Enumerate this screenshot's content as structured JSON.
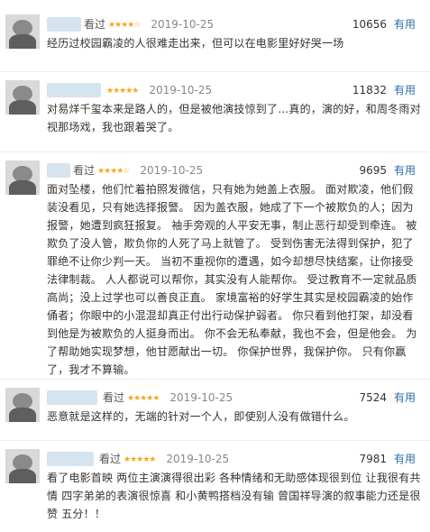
{
  "reviews": [
    {
      "seen": "看过",
      "stars": "★★★★☆",
      "date": "2019-10-25",
      "votes": "10656",
      "useful": "有用",
      "text": "经历过校园霸凌的人很难走出来，但可以在电影里好好哭一场"
    },
    {
      "seen": "看过",
      "stars": "★★★★★",
      "date": "2019-10-25",
      "votes": "11832",
      "useful": "有用",
      "text": "对易烊千玺本来是路人的，但是被他演技惊到了…真的，演的好，和周冬雨对视那场戏，我也跟着哭了。"
    },
    {
      "seen": "看过",
      "stars": "★★★★☆",
      "date": "2019-10-25",
      "votes": "9695",
      "useful": "有用",
      "text": "面对坠楼，他们忙着拍照发微信，只有她为她盖上衣服。 面对欺凌，他们假装没看见，只有她选择报警。 因为盖衣服，她成了下一个被欺负的人；因为报警，她遭到疯狂报复。 袖手旁观的人平安无事，制止恶行却受到牵连。 被欺负了没人管，欺负你的人死了马上就管了。 受到伤害无法得到保护，犯了罪绝不让你少判一天。 当初不重视你的遭遇，如今却想尽快结案，让你接受法律制裁。 人人都说可以帮你，其实没有人能帮你。 受过教育不一定就品质高尚；没上过学也可以善良正直。 家境富裕的好学生其实是校园霸凌的始作俑者；你眼中的小混混却真正付出行动保护弱者。 你只看到他打架，却没看到他是为被欺负的人挺身而出。 你不会无私奉献，我也不会，但是他会。 为了帮助她实现梦想，他甘愿献出一切。 你保护世界，我保护你。 只有你赢了，我才不算输。"
    },
    {
      "seen": "看过",
      "stars": "★★★★★",
      "date": "2019-10-25",
      "votes": "7524",
      "useful": "有用",
      "text": "恶意就是这样的，无端的针对一个人，即使别人没有做错什么。"
    },
    {
      "seen": "看过",
      "stars": "★★★★★",
      "date": "2019-10-25",
      "votes": "7981",
      "useful": "有用",
      "text": "看了电影首映 两位主演演得很出彩 各种情绪和无助感体现很到位 让我很有共情 四字弟弟的表演很惊喜 和小黄鸭搭档没有输 曾国祥导演的叙事能力还是很赞 五分！！"
    }
  ]
}
